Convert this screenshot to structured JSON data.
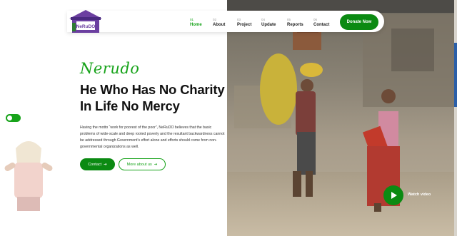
{
  "brand": {
    "logo_text": "NeRuDO",
    "logo_color": "#6b3fa0"
  },
  "nav": {
    "items": [
      {
        "num": "01",
        "label": "Home",
        "active": true
      },
      {
        "num": "02",
        "label": "About"
      },
      {
        "num": "03",
        "label": "Project"
      },
      {
        "num": "04",
        "label": "Update"
      },
      {
        "num": "05",
        "label": "Reports"
      },
      {
        "num": "06",
        "label": "Contact"
      }
    ],
    "donate_label": "Donate Now"
  },
  "hero": {
    "script_title": "Nerudo",
    "headline_line1": "He Who Has No Charity",
    "headline_line2": "In Life No Mercy",
    "description": "Having the motto “work for poorest of the poor”, NeRuDO believes that the basic problems of wide-scale and deep rooted poverty and the resultant backwardness cannot be addressed through Government's effort alone and efforts should come from non-governmental organizations as well.",
    "contact_label": "Contact",
    "about_label": "More about us",
    "watch_label": "Watch video"
  },
  "icons": {
    "arrow": "arrow-right-icon",
    "play": "play-icon"
  },
  "colors": {
    "accent": "#17a31a",
    "accent_dark": "#0b8a12"
  }
}
